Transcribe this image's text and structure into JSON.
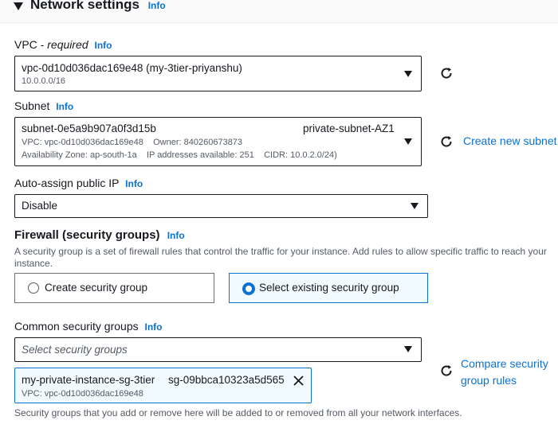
{
  "section": {
    "title": "Network settings",
    "info": "Info"
  },
  "vpc": {
    "label": "VPC",
    "required": "required",
    "info": "Info",
    "value": "vpc-0d10d036dac169e48 (my-3tier-priyanshu)",
    "cidr": "10.0.0.0/16"
  },
  "subnet": {
    "label": "Subnet",
    "info": "Info",
    "id": "subnet-0e5a9b907a0f3d15b",
    "name": "private-subnet-AZ1",
    "vpc_owner": "VPC: vpc-0d10d036dac169e48    Owner: 840260673873",
    "details": "Availability Zone: ap-south-1a    IP addresses available: 251    CIDR: 10.0.2.0/24)",
    "create_link": "Create new subnet"
  },
  "public_ip": {
    "label": "Auto-assign public IP",
    "info": "Info",
    "value": "Disable"
  },
  "firewall": {
    "title": "Firewall (security groups)",
    "info": "Info",
    "description": "A security group is a set of firewall rules that control the traffic for your instance. Add rules to allow specific traffic to reach your instance.",
    "option_create": "Create security group",
    "option_existing": "Select existing security group",
    "selected": "existing"
  },
  "common_sg": {
    "label": "Common security groups",
    "info": "Info",
    "placeholder": "Select security groups",
    "compare_link": "Compare security group rules",
    "chip": {
      "name": "my-private-instance-sg-3tier",
      "id": "sg-09bbca10323a5d565",
      "vpc": "VPC: vpc-0d10d036dac169e48"
    },
    "footer": "Security groups that you add or remove here will be added to or removed from all your network interfaces."
  },
  "icons": [
    "caret-down-icon",
    "dropdown-arrow-icon",
    "refresh-icon",
    "external-link-icon",
    "close-icon",
    "radio-icon"
  ],
  "colors": {
    "link": "#0972d3",
    "text": "#16191f",
    "muted": "#545b64",
    "selected_bg": "#f1faff"
  }
}
